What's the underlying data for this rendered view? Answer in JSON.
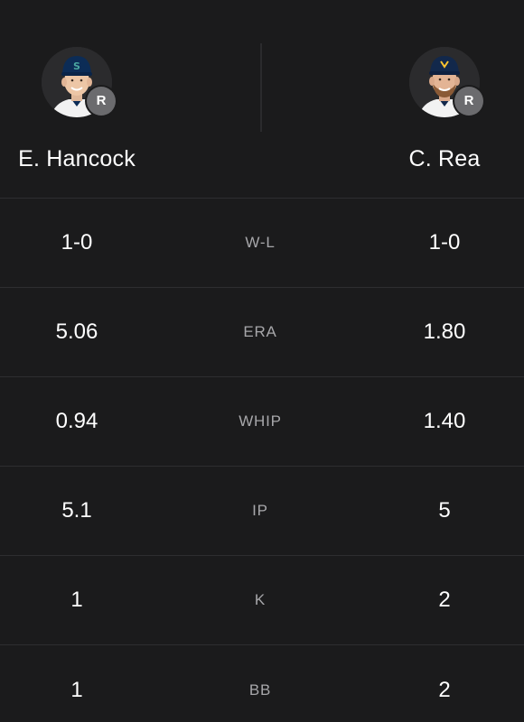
{
  "players": {
    "left": {
      "name": "E. Hancock",
      "hand": "R",
      "photo_icon": "mariners-player-headshot"
    },
    "right": {
      "name": "C. Rea",
      "hand": "R",
      "photo_icon": "brewers-player-headshot"
    }
  },
  "stats": [
    {
      "label": "W-L",
      "left": "1-0",
      "right": "1-0"
    },
    {
      "label": "ERA",
      "left": "5.06",
      "right": "1.80"
    },
    {
      "label": "WHIP",
      "left": "0.94",
      "right": "1.40"
    },
    {
      "label": "IP",
      "left": "5.1",
      "right": "5"
    },
    {
      "label": "K",
      "left": "1",
      "right": "2"
    },
    {
      "label": "BB",
      "left": "1",
      "right": "2"
    }
  ],
  "colors": {
    "background": "#1b1b1c",
    "divider": "#2e2e30",
    "label": "#a7a7aa",
    "badge": "#6b6b6e"
  }
}
